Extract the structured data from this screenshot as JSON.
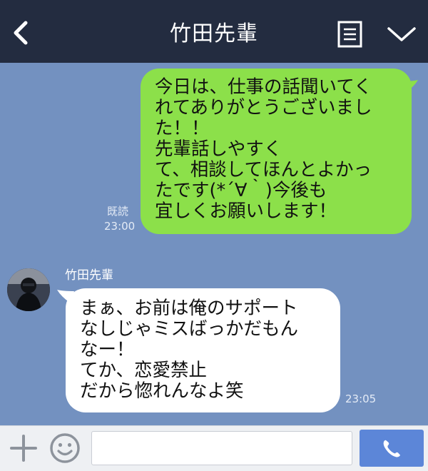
{
  "header": {
    "title": "竹田先輩",
    "back_icon": "chevron-left-icon",
    "menu_icon": "note-icon",
    "expand_icon": "chevron-down-icon"
  },
  "messages": {
    "outgoing": {
      "text": "今日は、仕事の話聞いてく\nれてありがとうございまし\nた！！\n先輩話しやすく\nて、相談してほんとよかっ\nたです(*´∀｀)今後も\n宜しくお願いします！",
      "read_label": "既読",
      "time": "23:00"
    },
    "incoming": {
      "sender": "竹田先輩",
      "text": "まぁ、お前は俺のサポート\nなしじゃミスばっかだもん\nなー！\nてか、恋愛禁止\nだから惚れんなよ笑",
      "time": "23:05"
    }
  },
  "input_bar": {
    "placeholder": "",
    "add_icon": "plus-icon",
    "emoji_icon": "smiley-icon",
    "call_icon": "phone-icon"
  },
  "colors": {
    "header_bg": "#232c40",
    "chat_bg": "#7391c0",
    "outgoing_bubble": "#8ce04a",
    "incoming_bubble": "#ffffff",
    "call_button": "#5c86d8"
  }
}
